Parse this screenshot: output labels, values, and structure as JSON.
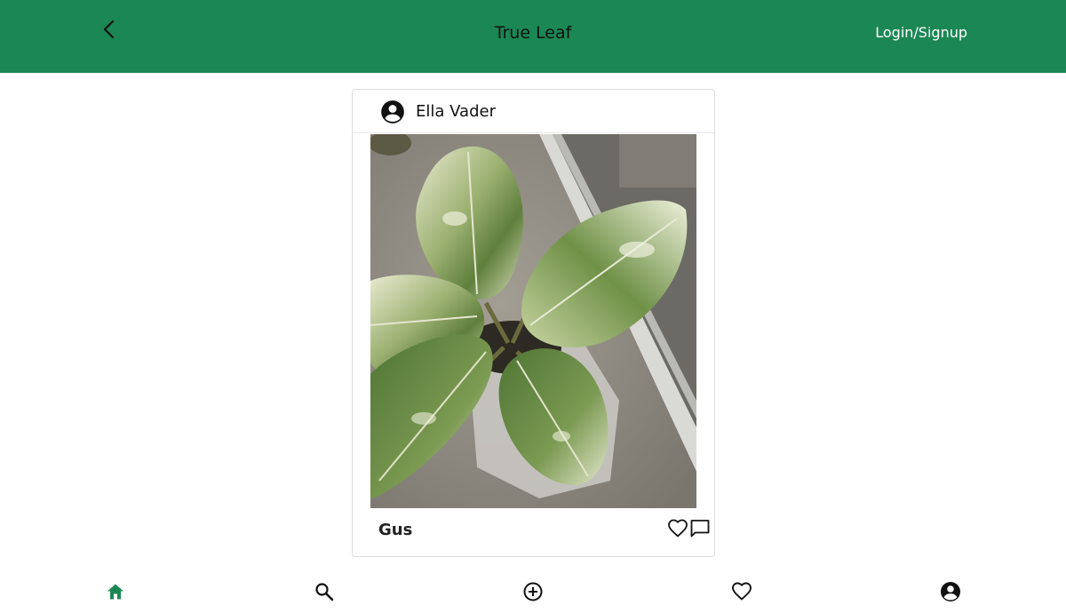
{
  "header": {
    "title": "True Leaf",
    "login_label": "Login/Signup",
    "background": "#1b8754"
  },
  "post": {
    "username": "Ella Vader",
    "plant_name": "Gus",
    "photo_icon": "variegated-rubber-plant-photo"
  },
  "icons": {
    "back": "chevron-left-icon",
    "avatar": "account-circle-icon",
    "like": "heart-outline-icon",
    "comment": "comment-outline-icon"
  },
  "bottom_nav": {
    "active_color": "#1b8754",
    "items": [
      {
        "icon": "home-icon",
        "active": true
      },
      {
        "icon": "search-icon",
        "active": false
      },
      {
        "icon": "add-circle-icon",
        "active": false
      },
      {
        "icon": "heart-icon",
        "active": false
      },
      {
        "icon": "account-circle-icon",
        "active": false
      }
    ]
  }
}
